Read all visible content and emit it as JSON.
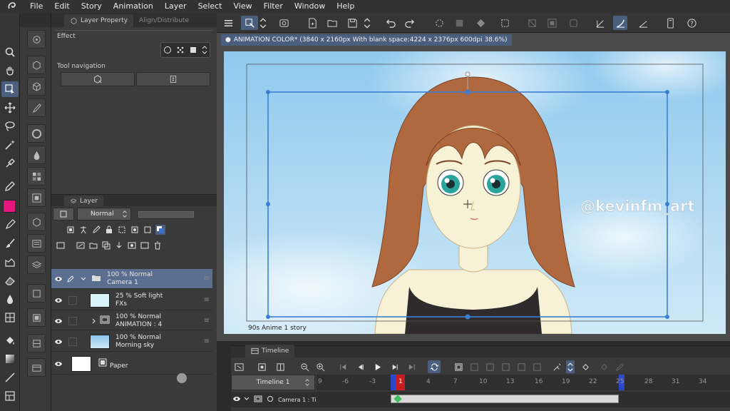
{
  "menu": {
    "items": [
      "File",
      "Edit",
      "Story",
      "Animation",
      "Layer",
      "Select",
      "View",
      "Filter",
      "Window",
      "Help"
    ]
  },
  "colors": {
    "accent": "#4a5f7e",
    "main_color": "#e6177f",
    "panel_bg": "#3c3c3c",
    "sky_blue": "#a9d4ee",
    "hair_brown": "#b0683e"
  },
  "layer_property": {
    "tab_label": "Layer Property",
    "other_tab_label": "Align/Distribute",
    "effect_label": "Effect",
    "tool_navigation_label": "Tool navigation"
  },
  "layers": {
    "tab_label": "Layer",
    "blend_mode": "Normal",
    "items": [
      {
        "line1": "100 % Normal",
        "line2": "Camera 1",
        "selected": true
      },
      {
        "line1": "25 % Soft light",
        "line2": "FXs",
        "selected": false
      },
      {
        "line1": "100 % Normal",
        "line2": "ANIMATION : 4",
        "selected": false
      },
      {
        "line1": "100 % Normal",
        "line2": "Morning sky",
        "selected": false
      },
      {
        "line1": "",
        "line2": "Paper",
        "selected": false
      }
    ]
  },
  "canvas": {
    "doc_tab": "ANIMATION COLOR* (3840 x 2160px With blank space:4224 x 2376px 600dpi 38.6%)",
    "story_label": "90s Anime 1 story",
    "watermark": "@kevinfm_art"
  },
  "timeline": {
    "tab_label": "Timeline",
    "name": "Timeline 1",
    "ticks": [
      "9",
      "-6",
      "-3",
      "1",
      "4",
      "7",
      "10",
      "13",
      "16",
      "19",
      "22",
      "25",
      "28",
      "31",
      "34"
    ],
    "current_frame": "1",
    "track_label": "Camera 1 : Ti"
  }
}
